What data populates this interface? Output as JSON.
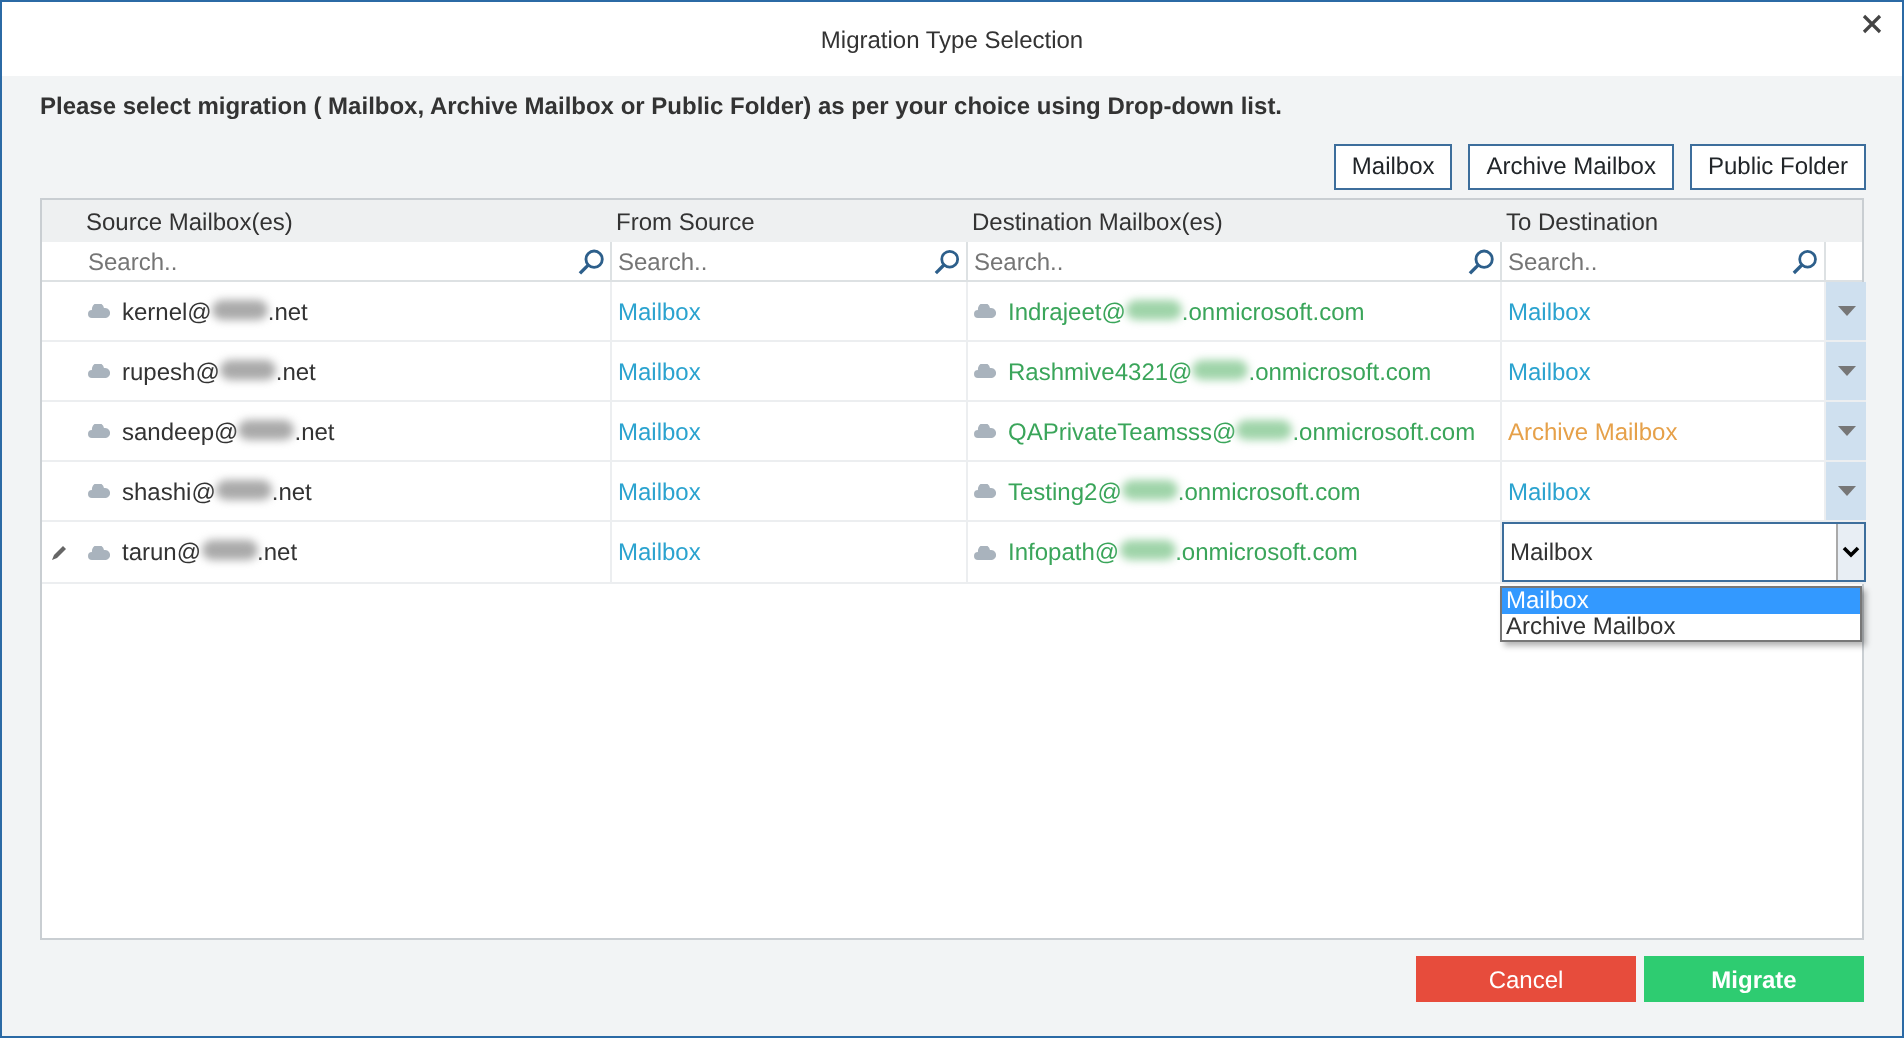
{
  "window": {
    "title": "Migration Type Selection"
  },
  "instruction": "Please select migration ( Mailbox, Archive Mailbox or Public Folder) as per your choice using Drop-down list.",
  "type_buttons": [
    "Mailbox",
    "Archive Mailbox",
    "Public Folder"
  ],
  "table": {
    "columns": [
      {
        "heading": "Source Mailbox(es)",
        "placeholder": "Search.."
      },
      {
        "heading": "From Source",
        "placeholder": "Search.."
      },
      {
        "heading": "Destination Mailbox(es)",
        "placeholder": "Search.."
      },
      {
        "heading": "To Destination",
        "placeholder": "Search.."
      }
    ],
    "rows": [
      {
        "editing": false,
        "source_user": "kernel@",
        "source_suffix": ".net",
        "from_source": "Mailbox",
        "destination_user": "Indrajeet@",
        "destination_suffix": ".onmicrosoft.com",
        "to_destination": "Mailbox",
        "color": "#2ba3cf"
      },
      {
        "editing": false,
        "source_user": "rupesh@",
        "source_suffix": ".net",
        "from_source": "Mailbox",
        "destination_user": "Rashmive4321@",
        "destination_suffix": ".onmicrosoft.com",
        "to_destination": "Mailbox",
        "color": "#2ba3cf"
      },
      {
        "editing": false,
        "source_user": "sandeep@",
        "source_suffix": ".net",
        "from_source": "Mailbox",
        "destination_user": "QAPrivateTeamsss@",
        "destination_suffix": ".onmicrosoft.com",
        "to_destination": "Archive Mailbox",
        "color": "#e6a14a"
      },
      {
        "editing": false,
        "source_user": "shashi@",
        "source_suffix": ".net",
        "from_source": "Mailbox",
        "destination_user": "Testing2@",
        "destination_suffix": ".onmicrosoft.com",
        "to_destination": "Mailbox",
        "color": "#2ba3cf"
      },
      {
        "editing": true,
        "source_user": "tarun@",
        "source_suffix": ".net",
        "from_source": "Mailbox",
        "destination_user": "Infopath@",
        "destination_suffix": ".onmicrosoft.com",
        "to_destination": "Mailbox",
        "color": "#333333",
        "options": [
          {
            "label": "Mailbox",
            "selected": true
          },
          {
            "label": "Archive Mailbox",
            "selected": false
          }
        ]
      }
    ]
  },
  "buttons": {
    "cancel": "Cancel",
    "migrate": "Migrate"
  }
}
